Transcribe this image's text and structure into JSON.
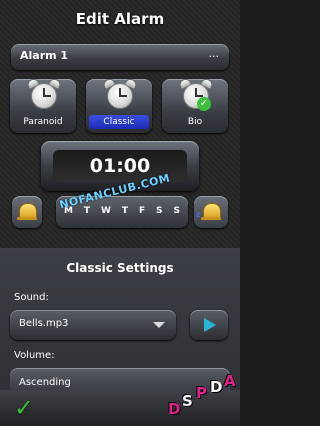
{
  "header": {
    "title": "Edit Alarm"
  },
  "alarm": {
    "name": "Alarm 1",
    "more_label": "..."
  },
  "profiles": [
    {
      "label": "Paranoid",
      "selected": false
    },
    {
      "label": "Classic",
      "selected": true
    },
    {
      "label": "Bio",
      "selected": false
    }
  ],
  "time": {
    "value": "01:00"
  },
  "days": [
    "M",
    "T",
    "W",
    "T",
    "F",
    "S",
    "S"
  ],
  "watermark": "NOFANCLUB.COM",
  "settings": {
    "title": "Classic Settings",
    "sound_label": "Sound:",
    "sound_value": "Bells.mp3",
    "volume_label": "Volume:",
    "volume_value": "Ascending"
  },
  "footer": {
    "ok_symbol": "✓",
    "brand_letters": [
      "D",
      "S",
      "P",
      "D",
      "A"
    ]
  },
  "colors": {
    "selected": "#2535c8",
    "play": "#29b3d6",
    "ok": "#37c13a",
    "brand": [
      "#e0208a",
      "#ffffff",
      "#e0208a",
      "#ffffff",
      "#e0208a"
    ]
  }
}
